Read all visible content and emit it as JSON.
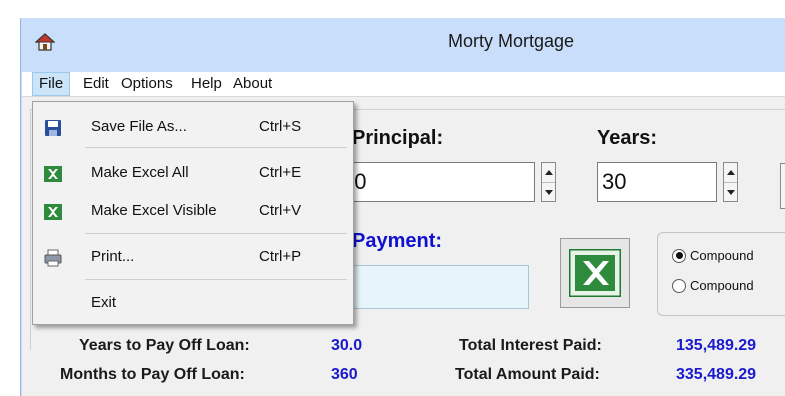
{
  "window": {
    "title": "Morty Mortgage"
  },
  "menubar": [
    {
      "label": "File"
    },
    {
      "label": "Edit"
    },
    {
      "label": "Options"
    },
    {
      "label": "Help"
    },
    {
      "label": "About"
    }
  ],
  "file_menu": [
    {
      "label": "Save File As...",
      "shortcut": "Ctrl+S",
      "icon": "floppy-disk-icon"
    },
    {
      "label": "Make Excel All",
      "shortcut": "Ctrl+E",
      "icon": "excel-icon"
    },
    {
      "label": "Make Excel Visible",
      "shortcut": "Ctrl+V",
      "icon": "excel-icon"
    },
    {
      "label": "Print...",
      "shortcut": "Ctrl+P",
      "icon": "printer-icon"
    },
    {
      "label": "Exit",
      "shortcut": "",
      "icon": ""
    }
  ],
  "form": {
    "principal_label": "Principal:",
    "principal_value": "00",
    "years_label": "Years:",
    "years_value": "30",
    "payment_label": "Payment:",
    "payment_value": ""
  },
  "compounding": {
    "options": [
      "Compound",
      "Compound"
    ],
    "selected_index": 0
  },
  "stats": {
    "years_to_pay_label": "Years to Pay Off Loan:",
    "years_to_pay_value": "30.0",
    "months_to_pay_label": "Months to Pay Off Loan:",
    "months_to_pay_value": "360",
    "total_interest_label": "Total Interest Paid:",
    "total_interest_value": "135,489.29",
    "total_amount_label": "Total Amount Paid:",
    "total_amount_value": "335,489.29"
  },
  "colors": {
    "accent_blue": "#1010d0",
    "window_frame": "#c9defa",
    "excel_green": "#1e7a2e"
  }
}
